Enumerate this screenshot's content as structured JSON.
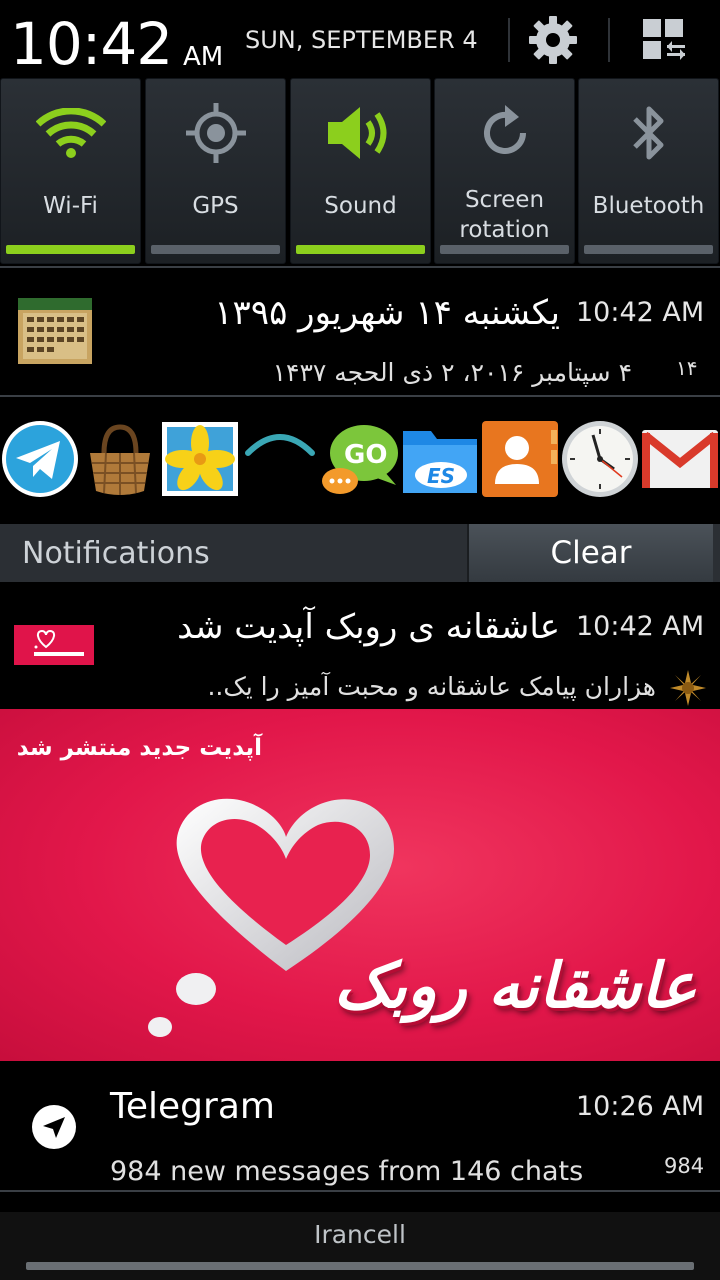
{
  "header": {
    "time": "10:42",
    "ampm": "AM",
    "date": "SUN, SEPTEMBER 4",
    "settings_icon": "gear-icon",
    "toggle_icon": "grid-edit-icon"
  },
  "quick_settings": [
    {
      "label": "Wi-Fi",
      "icon": "wifi-icon",
      "on": true
    },
    {
      "label": "GPS",
      "icon": "gps-icon",
      "on": false
    },
    {
      "label": "Sound",
      "icon": "sound-icon",
      "on": true
    },
    {
      "label": "Screen rotation",
      "icon": "rotation-icon",
      "on": false
    },
    {
      "label": "Bluetooth",
      "icon": "bluetooth-icon",
      "on": false
    }
  ],
  "calendar_notification": {
    "title": "یکشنبه ۱۴ شهریور ۱۳۹۵",
    "time": "10:42 AM",
    "subtitle": "۴ سپتامبر ۲۰۱۶، ۲ ذی الحجه ۱۴۳۷",
    "count": "۱۴"
  },
  "apps": [
    {
      "name": "telegram-app-icon"
    },
    {
      "name": "basket-app-icon"
    },
    {
      "name": "gallery-app-icon"
    },
    {
      "name": "arc-app-icon"
    },
    {
      "name": "go-sms-app-icon"
    },
    {
      "name": "es-file-explorer-app-icon"
    },
    {
      "name": "contacts-app-icon"
    },
    {
      "name": "clock-app-icon"
    },
    {
      "name": "gmail-app-icon"
    }
  ],
  "notifications": {
    "title": "Notifications",
    "clear": "Clear"
  },
  "robek_notification": {
    "title": "عاشقانه ی روبک آپدیت شد",
    "time": "10:42 AM",
    "subtitle": "هزاران پیامک عاشقانه و محبت آمیز را یک..",
    "banner_top": "آپدیت جدید منتشر شد",
    "banner_big": "عاشقانه روبک"
  },
  "telegram_notification": {
    "title": "Telegram",
    "time": "10:26 AM",
    "subtitle": "984 new messages from 146 chats",
    "count": "984"
  },
  "footer": {
    "carrier": "Irancell"
  },
  "colors": {
    "toggle_on": "#8ccf1d",
    "toggle_off": "#5a6169",
    "banner": "#e2174a"
  }
}
